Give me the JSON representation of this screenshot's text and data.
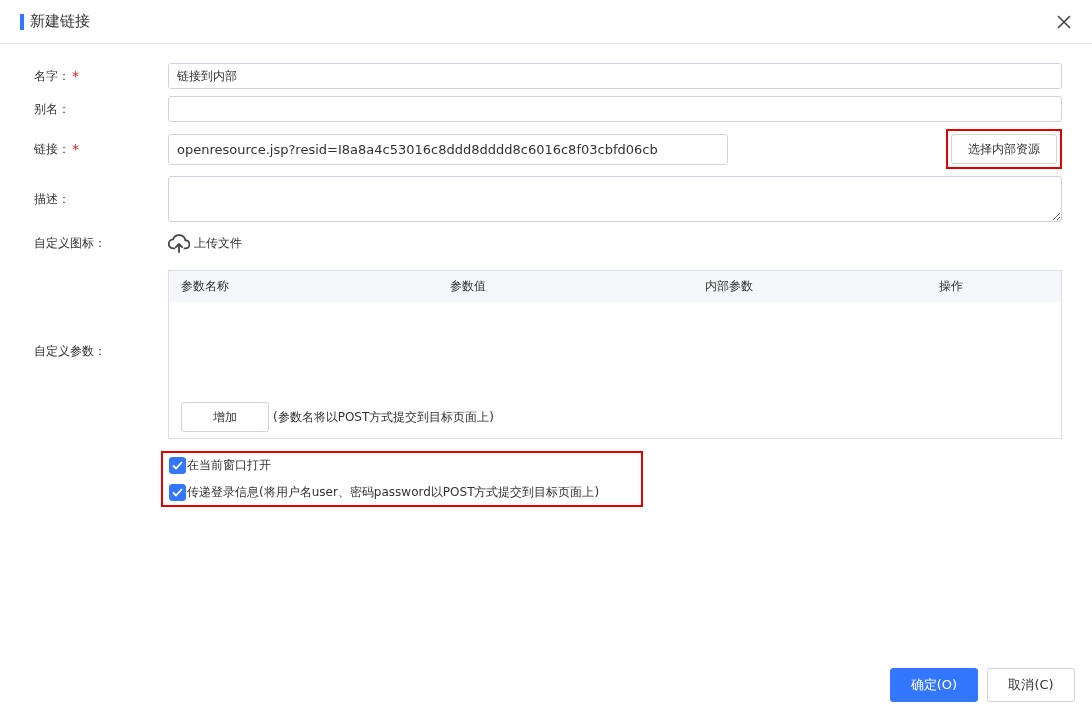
{
  "dialog": {
    "title": "新建链接"
  },
  "fields": [
    {
      "kind": "text",
      "label": "名字：",
      "required_mark": "*",
      "value": "链接到内部"
    },
    {
      "kind": "text",
      "label": "别名："
    },
    {
      "kind": "link",
      "label": "链接：",
      "required_mark": "*",
      "value": "openresource.jsp?resid=I8a8a4c53016c8ddd8dddd8c6016c8f03cbfd06cb",
      "button": "选择内部资源"
    },
    {
      "kind": "textarea",
      "label": "描述："
    },
    {
      "kind": "upload",
      "label": "自定义图标：",
      "button": "上传文件"
    }
  ],
  "params": {
    "label": "自定义参数：",
    "columns": [
      "参数名称",
      "参数值",
      "内部参数",
      "操作"
    ],
    "add_button": "增加",
    "note": "(参数名将以POST方式提交到目标页面上)"
  },
  "options": [
    {
      "label": "在当前窗口打开",
      "checked": true
    },
    {
      "label": "传递登录信息(将用户名user、密码password以POST方式提交到目标页面上)",
      "checked": true
    }
  ],
  "buttons": [
    {
      "label": "确定(O)",
      "primary": true
    },
    {
      "label": "取消(C)",
      "primary": false
    }
  ]
}
